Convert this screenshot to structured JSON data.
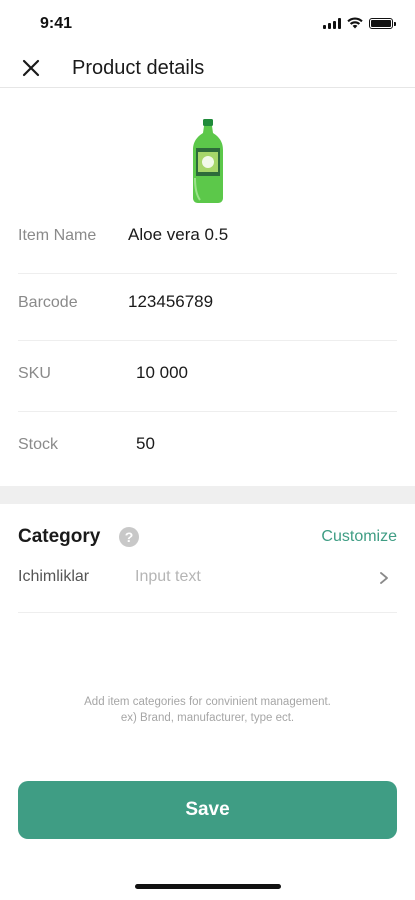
{
  "status_bar": {
    "time": "9:41",
    "icons": [
      "signal-icon",
      "wifi-icon",
      "battery-icon"
    ]
  },
  "header": {
    "title": "Product details",
    "close_icon": "close-icon"
  },
  "product": {
    "image_icon": "bottle-icon",
    "fields": [
      {
        "label": "Item Name",
        "value": "Aloe vera 0.5"
      },
      {
        "label": "Barcode",
        "value": "123456789"
      },
      {
        "label": "SKU",
        "value": "10 000"
      },
      {
        "label": "Stock",
        "value": "50"
      }
    ]
  },
  "category": {
    "title": "Category",
    "help_icon": "help-icon",
    "customize_label": "Customize",
    "name": "Ichimliklar",
    "input_placeholder": "Input text",
    "chevron_icon": "chevron-right-icon",
    "hint_line1": "Add item categories for convinient management.",
    "hint_line2": "ex) Brand, manufacturer, type ect."
  },
  "actions": {
    "save_label": "Save"
  },
  "colors": {
    "accent": "#3f9d84",
    "label_gray": "#8a8a8a",
    "divider": "#efefef"
  }
}
